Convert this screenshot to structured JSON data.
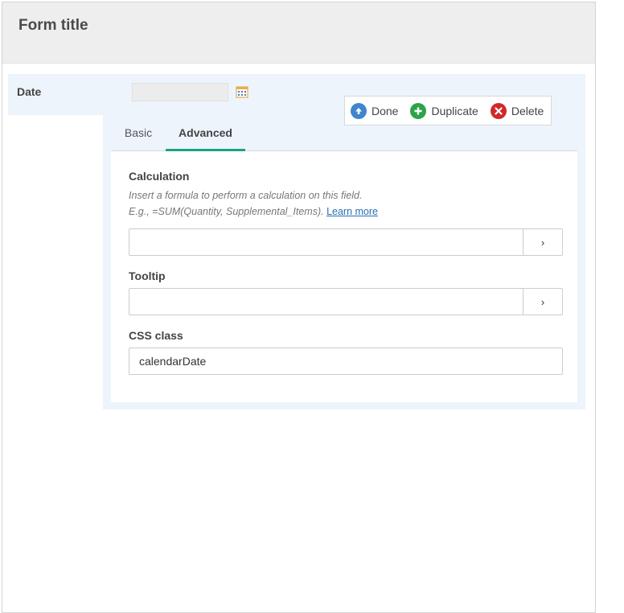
{
  "form": {
    "title": "Form title"
  },
  "date_field": {
    "label": "Date",
    "value": ""
  },
  "actions": {
    "done": "Done",
    "duplicate": "Duplicate",
    "delete": "Delete"
  },
  "tabs": [
    {
      "label": "Basic",
      "active": false
    },
    {
      "label": "Advanced",
      "active": true
    }
  ],
  "advanced": {
    "calculation": {
      "label": "Calculation",
      "help_line1": "Insert a formula to perform a calculation on this field.",
      "help_line2": "E.g., =SUM(Quantity, Supplemental_Items).",
      "learn_more": "Learn more",
      "value": "",
      "addon": "›"
    },
    "tooltip": {
      "label": "Tooltip",
      "value": "",
      "addon": "›"
    },
    "css_class": {
      "label": "CSS class",
      "value": "calendarDate"
    }
  },
  "colors": {
    "accent": "#1aa386",
    "done": "#3f86cc",
    "duplicate": "#2ea34a",
    "delete": "#cf2a2a",
    "panel": "#eef4fc"
  }
}
